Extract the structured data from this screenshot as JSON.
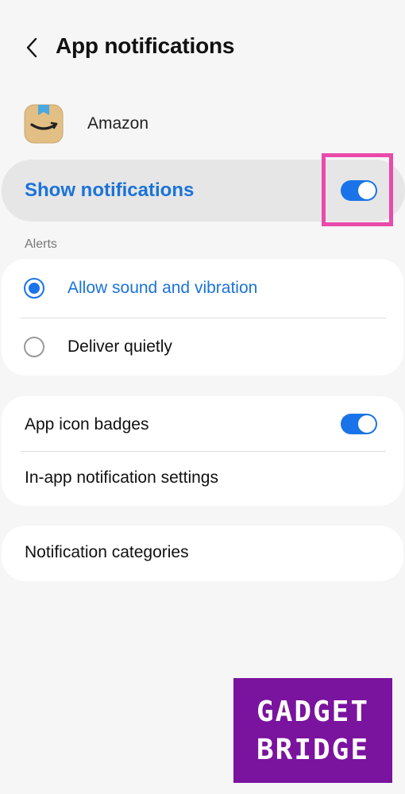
{
  "header": {
    "title": "App notifications",
    "back_icon": "chevron-left-icon"
  },
  "app": {
    "name": "Amazon",
    "icon": "amazon-smile-box-icon"
  },
  "master": {
    "label": "Show notifications",
    "enabled": true
  },
  "alerts": {
    "section_label": "Alerts",
    "options": [
      {
        "label": "Allow sound and vibration",
        "selected": true
      },
      {
        "label": "Deliver quietly",
        "selected": false
      }
    ]
  },
  "settings": {
    "badges_label": "App icon badges",
    "badges_enabled": true,
    "in_app_label": "In-app notification settings",
    "categories_label": "Notification categories"
  },
  "watermark": {
    "line1": "GADGET",
    "line2": "BRIDGE"
  },
  "colors": {
    "accent": "#1a73e8",
    "highlight": "#e94aab",
    "watermark_bg": "#7a139e"
  }
}
